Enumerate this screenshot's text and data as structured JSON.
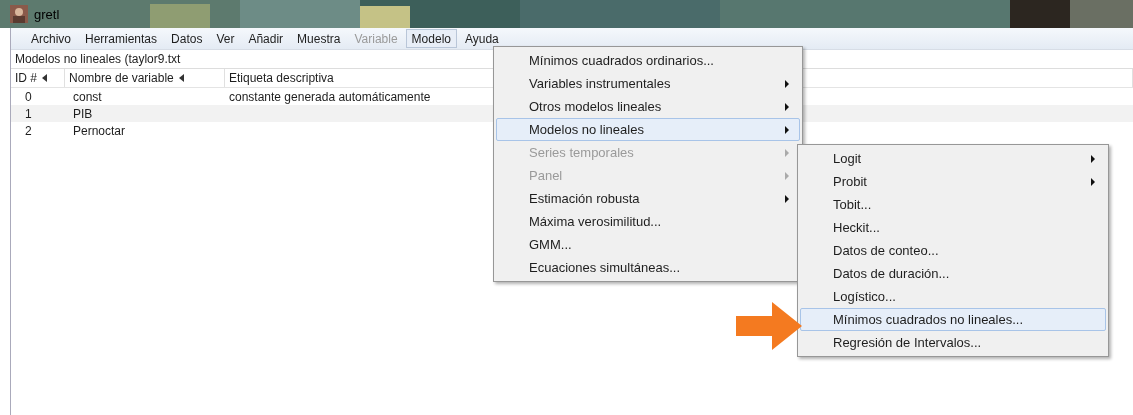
{
  "window": {
    "title": "gretl"
  },
  "menubar": [
    {
      "label": "Archivo",
      "selected": false,
      "disabled": false
    },
    {
      "label": "Herramientas",
      "selected": false,
      "disabled": false
    },
    {
      "label": "Datos",
      "selected": false,
      "disabled": false
    },
    {
      "label": "Ver",
      "selected": false,
      "disabled": false
    },
    {
      "label": "Añadir",
      "selected": false,
      "disabled": false
    },
    {
      "label": "Muestra",
      "selected": false,
      "disabled": false
    },
    {
      "label": "Variable",
      "selected": false,
      "disabled": true
    },
    {
      "label": "Modelo",
      "selected": true,
      "disabled": false
    },
    {
      "label": "Ayuda",
      "selected": false,
      "disabled": false
    }
  ],
  "status_line": "Modelos no lineales (taylor9.txt",
  "table": {
    "columns": [
      "ID #",
      "Nombre de variable",
      "Etiqueta descriptiva"
    ],
    "rows": [
      [
        "0",
        "const",
        "constante generada automáticamente"
      ],
      [
        "1",
        "PIB",
        ""
      ],
      [
        "2",
        "Pernoctar",
        ""
      ]
    ]
  },
  "menu": [
    {
      "label": "Mínimos cuadrados ordinarios...",
      "submenu": false,
      "disabled": false,
      "selected": false
    },
    {
      "label": "Variables instrumentales",
      "submenu": true,
      "disabled": false,
      "selected": false
    },
    {
      "label": "Otros modelos lineales",
      "submenu": true,
      "disabled": false,
      "selected": false
    },
    {
      "label": "Modelos no lineales",
      "submenu": true,
      "disabled": false,
      "selected": true
    },
    {
      "label": "Series temporales",
      "submenu": true,
      "disabled": true,
      "selected": false
    },
    {
      "label": "Panel",
      "submenu": true,
      "disabled": true,
      "selected": false
    },
    {
      "label": "Estimación robusta",
      "submenu": true,
      "disabled": false,
      "selected": false
    },
    {
      "label": "Máxima verosimilitud...",
      "submenu": false,
      "disabled": false,
      "selected": false
    },
    {
      "label": "GMM...",
      "submenu": false,
      "disabled": false,
      "selected": false
    },
    {
      "label": "Ecuaciones simultáneas...",
      "submenu": false,
      "disabled": false,
      "selected": false
    }
  ],
  "submenu": [
    {
      "label": "Logit",
      "submenu": true,
      "disabled": false,
      "selected": false
    },
    {
      "label": "Probit",
      "submenu": true,
      "disabled": false,
      "selected": false
    },
    {
      "label": "Tobit...",
      "submenu": false,
      "disabled": false,
      "selected": false
    },
    {
      "label": "Heckit...",
      "submenu": false,
      "disabled": false,
      "selected": false
    },
    {
      "label": "Datos de conteo...",
      "submenu": false,
      "disabled": false,
      "selected": false
    },
    {
      "label": "Datos de duración...",
      "submenu": false,
      "disabled": false,
      "selected": false
    },
    {
      "label": "Logístico...",
      "submenu": false,
      "disabled": false,
      "selected": false
    },
    {
      "label": "Mínimos cuadrados no lineales...",
      "submenu": false,
      "disabled": false,
      "selected": true
    },
    {
      "label": "Regresión de Intervalos...",
      "submenu": false,
      "disabled": false,
      "selected": false
    }
  ]
}
